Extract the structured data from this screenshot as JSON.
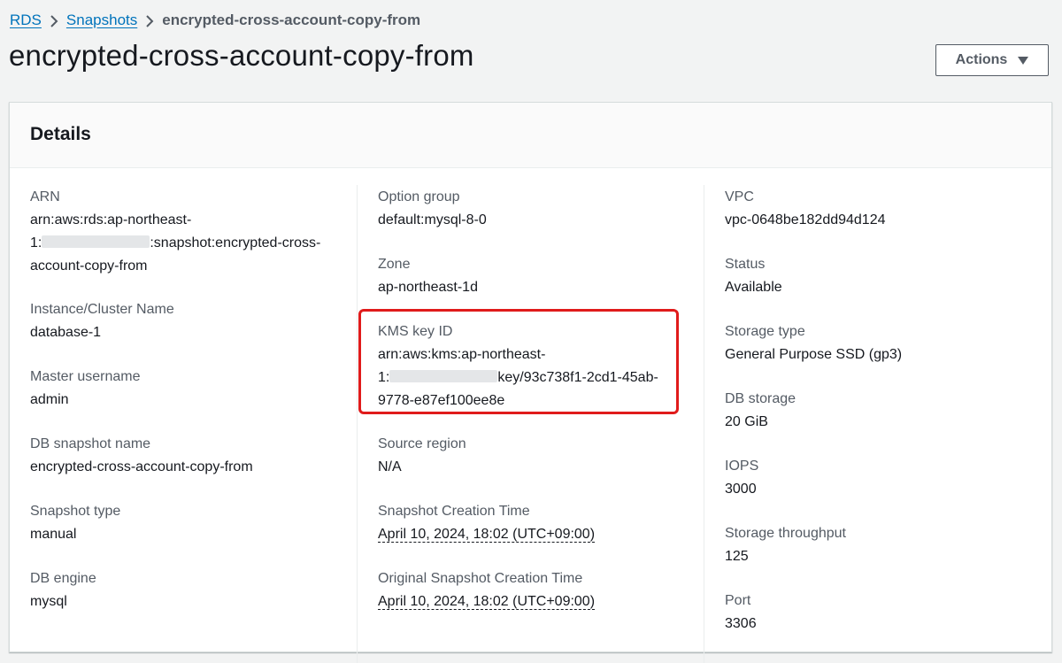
{
  "breadcrumb": {
    "rds": "RDS",
    "snapshots": "Snapshots",
    "current": "encrypted-cross-account-copy-from"
  },
  "page_title": "encrypted-cross-account-copy-from",
  "actions_label": "Actions",
  "details": {
    "title": "Details",
    "col1": {
      "arn_label": "ARN",
      "arn_line1": "arn:aws:rds:ap-northeast-",
      "arn_line2_prefix": "1:",
      "arn_line2_suffix": ":snapshot:encrypted-cross-",
      "arn_line3": "account-copy-from",
      "instance_label": "Instance/Cluster Name",
      "instance_value": "database-1",
      "master_label": "Master username",
      "master_value": "admin",
      "snapshot_name_label": "DB snapshot name",
      "snapshot_name_value": "encrypted-cross-account-copy-from",
      "snapshot_type_label": "Snapshot type",
      "snapshot_type_value": "manual",
      "engine_label": "DB engine",
      "engine_value": "mysql"
    },
    "col2": {
      "option_group_label": "Option group",
      "option_group_value": "default:mysql-8-0",
      "zone_label": "Zone",
      "zone_value": "ap-northeast-1d",
      "kms_label": "KMS key ID",
      "kms_line1": "arn:aws:kms:ap-northeast-",
      "kms_line2_prefix": "1:",
      "kms_line2_suffix": "key/93c738f1-2cd1-45ab-",
      "kms_line3": "9778-e87ef100ee8e",
      "source_region_label": "Source region",
      "source_region_value": "N/A",
      "creation_time_label": "Snapshot Creation Time",
      "creation_time_value": "April 10, 2024, 18:02 (UTC+09:00)",
      "orig_creation_time_label": "Original Snapshot Creation Time",
      "orig_creation_time_value": "April 10, 2024, 18:02 (UTC+09:00)"
    },
    "col3": {
      "vpc_label": "VPC",
      "vpc_value": "vpc-0648be182dd94d124",
      "status_label": "Status",
      "status_value": "Available",
      "storage_type_label": "Storage type",
      "storage_type_value": "General Purpose SSD (gp3)",
      "db_storage_label": "DB storage",
      "db_storage_value": "20 GiB",
      "iops_label": "IOPS",
      "iops_value": "3000",
      "throughput_label": "Storage throughput",
      "throughput_value": "125",
      "port_label": "Port",
      "port_value": "3306"
    }
  },
  "colors": {
    "link": "#0073bb",
    "highlight": "#e01b1b",
    "label": "#545b64"
  }
}
